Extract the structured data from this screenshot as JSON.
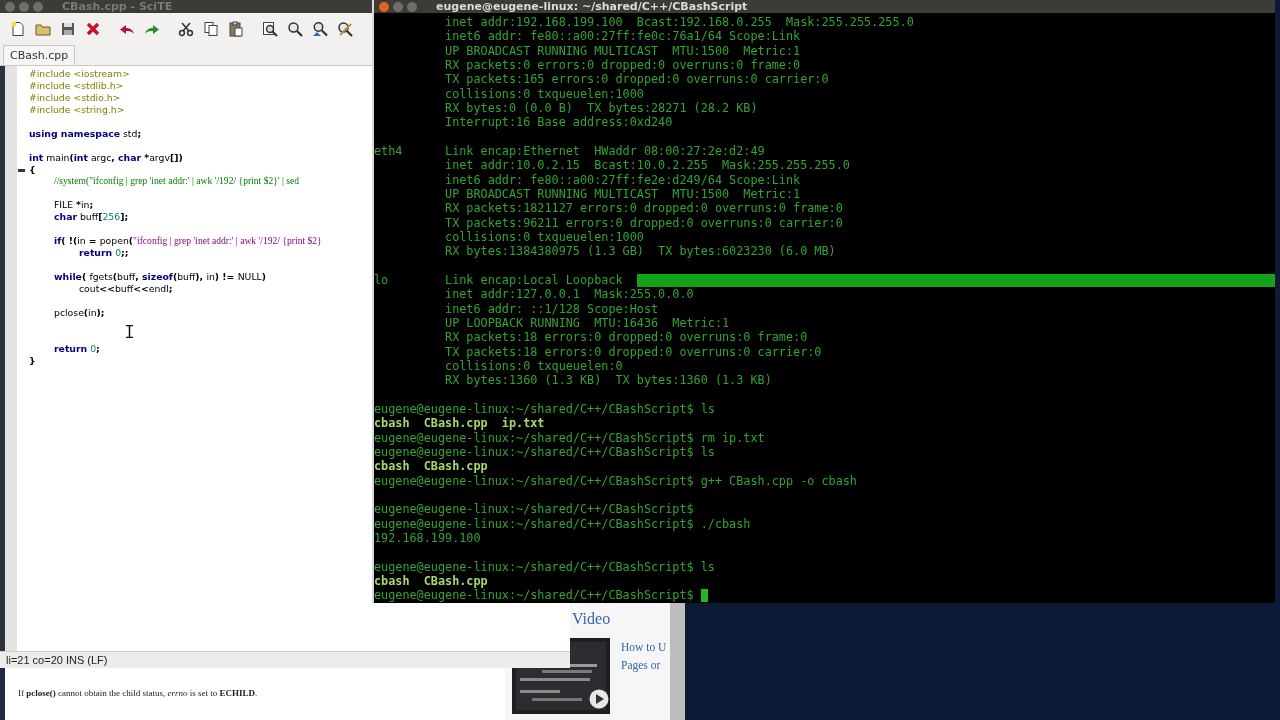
{
  "scite": {
    "title": "CBash.cpp - SciTE",
    "toolbar_groups": [
      [
        {
          "kind": "new"
        },
        {
          "kind": "open"
        },
        {
          "kind": "save"
        },
        {
          "kind": "close"
        }
      ],
      [
        {
          "kind": "undo"
        },
        {
          "kind": "redo"
        }
      ],
      [
        {
          "kind": "cut"
        },
        {
          "kind": "copy"
        },
        {
          "kind": "paste"
        }
      ],
      [
        {
          "kind": "find"
        },
        {
          "kind": "search"
        },
        {
          "kind": "find-next"
        },
        {
          "kind": "replace"
        }
      ]
    ],
    "tabs": [
      {
        "label": "CBash.cpp",
        "selected": true
      }
    ],
    "code_lines": [
      {
        "kind": "code",
        "fold": false,
        "segments": [
          {
            "kind": "pre",
            "text": "#include <iostream>"
          }
        ]
      },
      {
        "kind": "code",
        "fold": false,
        "segments": [
          {
            "kind": "pre",
            "text": "#include <stdlib.h>"
          }
        ]
      },
      {
        "kind": "code",
        "fold": false,
        "segments": [
          {
            "kind": "pre",
            "text": "#include <stdio.h>"
          }
        ]
      },
      {
        "kind": "code",
        "fold": false,
        "segments": [
          {
            "kind": "pre",
            "text": "#include <string.h>"
          }
        ]
      },
      {
        "kind": "blank"
      },
      {
        "kind": "code",
        "fold": false,
        "segments": [
          {
            "kind": "kw",
            "text": "using"
          },
          {
            "kind": "kw",
            "text": " namespace"
          },
          {
            "kind": "id",
            "text": " std"
          },
          {
            "kind": "op",
            "text": ";"
          }
        ]
      },
      {
        "kind": "blank"
      },
      {
        "kind": "code",
        "fold": false,
        "segments": [
          {
            "kind": "kw",
            "text": "int"
          },
          {
            "kind": "id",
            "text": " main"
          },
          {
            "kind": "op",
            "text": "("
          },
          {
            "kind": "kw",
            "text": "int"
          },
          {
            "kind": "id",
            "text": " argc"
          },
          {
            "kind": "op",
            "text": ", "
          },
          {
            "kind": "kw",
            "text": "char"
          },
          {
            "kind": "op",
            "text": " *"
          },
          {
            "kind": "id",
            "text": "argv"
          },
          {
            "kind": "op",
            "text": "[])"
          }
        ]
      },
      {
        "kind": "code",
        "fold": true,
        "segments": [
          {
            "kind": "op",
            "text": "{"
          }
        ]
      },
      {
        "kind": "code",
        "fold": false,
        "segments": [
          {
            "kind": "comment",
            "text": "\t//system(\"ifconfig | grep 'inet addr:' | awk '/192/ {print $2}' | sed"
          }
        ]
      },
      {
        "kind": "blank"
      },
      {
        "kind": "code",
        "fold": false,
        "segments": [
          {
            "kind": "id",
            "text": "\tFILE "
          },
          {
            "kind": "op",
            "text": "*"
          },
          {
            "kind": "id",
            "text": "in"
          },
          {
            "kind": "op",
            "text": ";"
          }
        ]
      },
      {
        "kind": "code",
        "fold": false,
        "segments": [
          {
            "kind": "kw",
            "text": "\tchar"
          },
          {
            "kind": "id",
            "text": " buff"
          },
          {
            "kind": "op",
            "text": "["
          },
          {
            "kind": "num",
            "text": "256"
          },
          {
            "kind": "op",
            "text": "];"
          }
        ]
      },
      {
        "kind": "blank"
      },
      {
        "kind": "code",
        "fold": false,
        "segments": [
          {
            "kind": "kw",
            "text": "\tif"
          },
          {
            "kind": "op",
            "text": "( !("
          },
          {
            "kind": "id",
            "text": "in "
          },
          {
            "kind": "op",
            "text": "= "
          },
          {
            "kind": "id",
            "text": "popen"
          },
          {
            "kind": "op",
            "text": "("
          },
          {
            "kind": "string",
            "text": "\"ifconfig | grep 'inet addr:' | awk '/192/ {print $2}"
          }
        ]
      },
      {
        "kind": "code",
        "fold": false,
        "segments": [
          {
            "kind": "kw",
            "text": "\t\treturn"
          },
          {
            "kind": "num",
            "text": " 0"
          },
          {
            "kind": "op",
            "text": ";;"
          }
        ]
      },
      {
        "kind": "blank"
      },
      {
        "kind": "code",
        "fold": false,
        "segments": [
          {
            "kind": "kw",
            "text": "\twhile"
          },
          {
            "kind": "op",
            "text": "( "
          },
          {
            "kind": "id",
            "text": "fgets"
          },
          {
            "kind": "op",
            "text": "("
          },
          {
            "kind": "id",
            "text": "buff"
          },
          {
            "kind": "op",
            "text": ", "
          },
          {
            "kind": "kw",
            "text": "sizeof"
          },
          {
            "kind": "op",
            "text": "("
          },
          {
            "kind": "id",
            "text": "buff"
          },
          {
            "kind": "op",
            "text": "), "
          },
          {
            "kind": "id",
            "text": "in"
          },
          {
            "kind": "op",
            "text": ") != "
          },
          {
            "kind": "id",
            "text": "NULL"
          },
          {
            "kind": "op",
            "text": ")"
          }
        ]
      },
      {
        "kind": "code",
        "fold": false,
        "segments": [
          {
            "kind": "id",
            "text": "\t\tcout"
          },
          {
            "kind": "op",
            "text": "<<"
          },
          {
            "kind": "id",
            "text": "buff"
          },
          {
            "kind": "op",
            "text": "<<"
          },
          {
            "kind": "id",
            "text": "endl"
          },
          {
            "kind": "op",
            "text": ";"
          }
        ]
      },
      {
        "kind": "blank"
      },
      {
        "kind": "code",
        "fold": false,
        "segments": [
          {
            "kind": "id",
            "text": "\tpclose"
          },
          {
            "kind": "op",
            "text": "("
          },
          {
            "kind": "id",
            "text": "in"
          },
          {
            "kind": "op",
            "text": ");"
          }
        ]
      },
      {
        "kind": "blank"
      },
      {
        "kind": "blank"
      },
      {
        "kind": "code",
        "fold": false,
        "segments": [
          {
            "kind": "kw",
            "text": "\treturn"
          },
          {
            "kind": "num",
            "text": " 0"
          },
          {
            "kind": "op",
            "text": ";"
          }
        ]
      },
      {
        "kind": "code",
        "fold": false,
        "segments": [
          {
            "kind": "op",
            "text": "}"
          }
        ]
      }
    ],
    "status": "li=21 co=20 INS (LF)"
  },
  "terminal": {
    "title": "eugene@eugene-linux: ~/shared/C++/CBashScript",
    "lines": [
      {
        "kind": "output",
        "highlight": false,
        "text": "          inet addr:192.168.199.100  Bcast:192.168.0.255  Mask:255.255.255.0"
      },
      {
        "kind": "output",
        "highlight": false,
        "text": "          inet6 addr: fe80::a00:27ff:fe0c:76a1/64 Scope:Link"
      },
      {
        "kind": "output",
        "highlight": false,
        "text": "          UP BROADCAST RUNNING MULTICAST  MTU:1500  Metric:1"
      },
      {
        "kind": "output",
        "highlight": false,
        "text": "          RX packets:0 errors:0 dropped:0 overruns:0 frame:0"
      },
      {
        "kind": "output",
        "highlight": false,
        "text": "          TX packets:165 errors:0 dropped:0 overruns:0 carrier:0"
      },
      {
        "kind": "output",
        "highlight": false,
        "text": "          collisions:0 txqueuelen:1000"
      },
      {
        "kind": "output",
        "highlight": false,
        "text": "          RX bytes:0 (0.0 B)  TX bytes:28271 (28.2 KB)"
      },
      {
        "kind": "output",
        "highlight": false,
        "text": "          Interrupt:16 Base address:0xd240"
      },
      {
        "kind": "blank"
      },
      {
        "kind": "output",
        "highlight": false,
        "text": "eth4      Link encap:Ethernet  HWaddr 08:00:27:2e:d2:49"
      },
      {
        "kind": "output",
        "highlight": false,
        "text": "          inet addr:10.0.2.15  Bcast:10.0.2.255  Mask:255.255.255.0"
      },
      {
        "kind": "output",
        "highlight": false,
        "text": "          inet6 addr: fe80::a00:27ff:fe2e:d249/64 Scope:Link"
      },
      {
        "kind": "output",
        "highlight": false,
        "text": "          UP BROADCAST RUNNING MULTICAST  MTU:1500  Metric:1"
      },
      {
        "kind": "output",
        "highlight": false,
        "text": "          RX packets:1821127 errors:0 dropped:0 overruns:0 frame:0"
      },
      {
        "kind": "output",
        "highlight": false,
        "text": "          TX packets:96211 errors:0 dropped:0 overruns:0 carrier:0"
      },
      {
        "kind": "output",
        "highlight": false,
        "text": "          collisions:0 txqueuelen:1000"
      },
      {
        "kind": "output",
        "highlight": false,
        "text": "          RX bytes:1384380975 (1.3 GB)  TX bytes:6023230 (6.0 MB)"
      },
      {
        "kind": "blank"
      },
      {
        "kind": "output",
        "highlight": true,
        "text": "lo        Link encap:Local Loopback"
      },
      {
        "kind": "output",
        "highlight": false,
        "text": "          inet addr:127.0.0.1  Mask:255.0.0.0"
      },
      {
        "kind": "output",
        "highlight": false,
        "text": "          inet6 addr: ::1/128 Scope:Host"
      },
      {
        "kind": "output",
        "highlight": false,
        "text": "          UP LOOPBACK RUNNING  MTU:16436  Metric:1"
      },
      {
        "kind": "output",
        "highlight": false,
        "text": "          RX packets:18 errors:0 dropped:0 overruns:0 frame:0"
      },
      {
        "kind": "output",
        "highlight": false,
        "text": "          TX packets:18 errors:0 dropped:0 overruns:0 carrier:0"
      },
      {
        "kind": "output",
        "highlight": false,
        "text": "          collisions:0 txqueuelen:0"
      },
      {
        "kind": "output",
        "highlight": false,
        "text": "          RX bytes:1360 (1.3 KB)  TX bytes:1360 (1.3 KB)"
      },
      {
        "kind": "blank"
      },
      {
        "kind": "prompt",
        "cursor": false,
        "text": "eugene@eugene-linux:~/shared/C++/CBashScript$ ls"
      },
      {
        "kind": "listing",
        "text": "cbash  CBash.cpp  ip.txt"
      },
      {
        "kind": "prompt",
        "cursor": false,
        "text": "eugene@eugene-linux:~/shared/C++/CBashScript$ rm ip.txt"
      },
      {
        "kind": "prompt",
        "cursor": false,
        "text": "eugene@eugene-linux:~/shared/C++/CBashScript$ ls"
      },
      {
        "kind": "listing",
        "text": "cbash  CBash.cpp"
      },
      {
        "kind": "prompt",
        "cursor": false,
        "text": "eugene@eugene-linux:~/shared/C++/CBashScript$ g++ CBash.cpp -o cbash"
      },
      {
        "kind": "blank"
      },
      {
        "kind": "prompt",
        "cursor": false,
        "text": "eugene@eugene-linux:~/shared/C++/CBashScript$"
      },
      {
        "kind": "prompt",
        "cursor": false,
        "text": "eugene@eugene-linux:~/shared/C++/CBashScript$ ./cbash"
      },
      {
        "kind": "output",
        "highlight": false,
        "text": "192.168.199.100"
      },
      {
        "kind": "blank"
      },
      {
        "kind": "prompt",
        "cursor": false,
        "text": "eugene@eugene-linux:~/shared/C++/CBashScript$ ls"
      },
      {
        "kind": "listing",
        "text": "cbash  CBash.cpp"
      },
      {
        "kind": "prompt",
        "cursor": true,
        "text": "eugene@eugene-linux:~/shared/C++/CBashScript$"
      }
    ]
  },
  "browser": {
    "sidebar_heading": "Video",
    "video_title_lines": [
      "How to U",
      "Pages or"
    ],
    "video_thumbnail": {
      "kind": "picture"
    },
    "paragraph": "If **pclose()** cannot obtain the child status, *errno* is set to **ECHILD**."
  }
}
